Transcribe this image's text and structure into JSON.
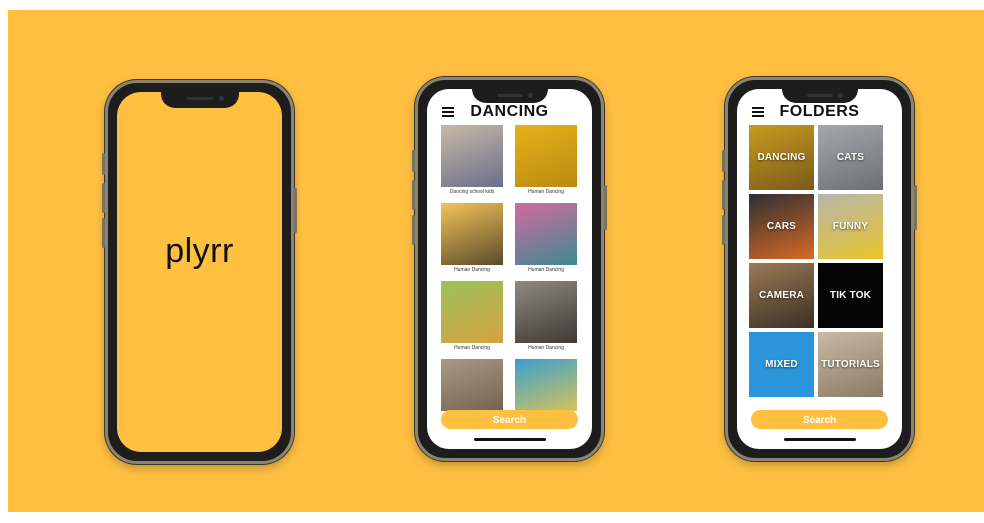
{
  "splash": {
    "logo_text": "plyrr"
  },
  "dancing_screen": {
    "title": "DANCING",
    "menu_icon": "hamburger-menu-icon",
    "items": [
      {
        "caption": "Dancing school kids",
        "colors": [
          "#c8b9a8",
          "#6b6f8a"
        ]
      },
      {
        "caption": "Human Dancing",
        "colors": [
          "#e7b21b",
          "#b98a10"
        ]
      },
      {
        "caption": "Human Dancing",
        "colors": [
          "#f3c35a",
          "#5b4a2a"
        ]
      },
      {
        "caption": "Human Dancing",
        "colors": [
          "#d16aa0",
          "#3e8a91"
        ]
      },
      {
        "caption": "Human Dancing",
        "colors": [
          "#9bc15a",
          "#d8a242"
        ]
      },
      {
        "caption": "Human Dancing",
        "colors": [
          "#8e8a80",
          "#3e3a34"
        ]
      },
      {
        "caption": "",
        "colors": [
          "#a89a86",
          "#6e5b45"
        ]
      },
      {
        "caption": "",
        "colors": [
          "#3a9fd0",
          "#e9c84a"
        ]
      }
    ],
    "search_label": "Search"
  },
  "folders_screen": {
    "title": "FOLDERS",
    "menu_icon": "hamburger-menu-icon",
    "folders": [
      {
        "label": "DANCING",
        "colors": [
          "#c99a1e",
          "#7a5a1b"
        ]
      },
      {
        "label": "CATS",
        "colors": [
          "#a6a7ae",
          "#6d6e76"
        ]
      },
      {
        "label": "CARS",
        "colors": [
          "#2e2f33",
          "#d86a24"
        ]
      },
      {
        "label": "FUNNY",
        "colors": [
          "#b5b6ad",
          "#e9c52a"
        ]
      },
      {
        "label": "CAMERA",
        "colors": [
          "#9b7a56",
          "#3b2f24"
        ]
      },
      {
        "label": "TIK TOK",
        "colors": [
          "#050505",
          "#050505"
        ]
      },
      {
        "label": "MIXED",
        "colors": [
          "#2b95d9",
          "#2b95d9"
        ]
      },
      {
        "label": "TUTORIALS",
        "colors": [
          "#c9b9a4",
          "#8a7a66"
        ]
      }
    ],
    "search_label": "Search"
  },
  "colors": {
    "background": "#FFC041",
    "accent": "#FFC041"
  }
}
